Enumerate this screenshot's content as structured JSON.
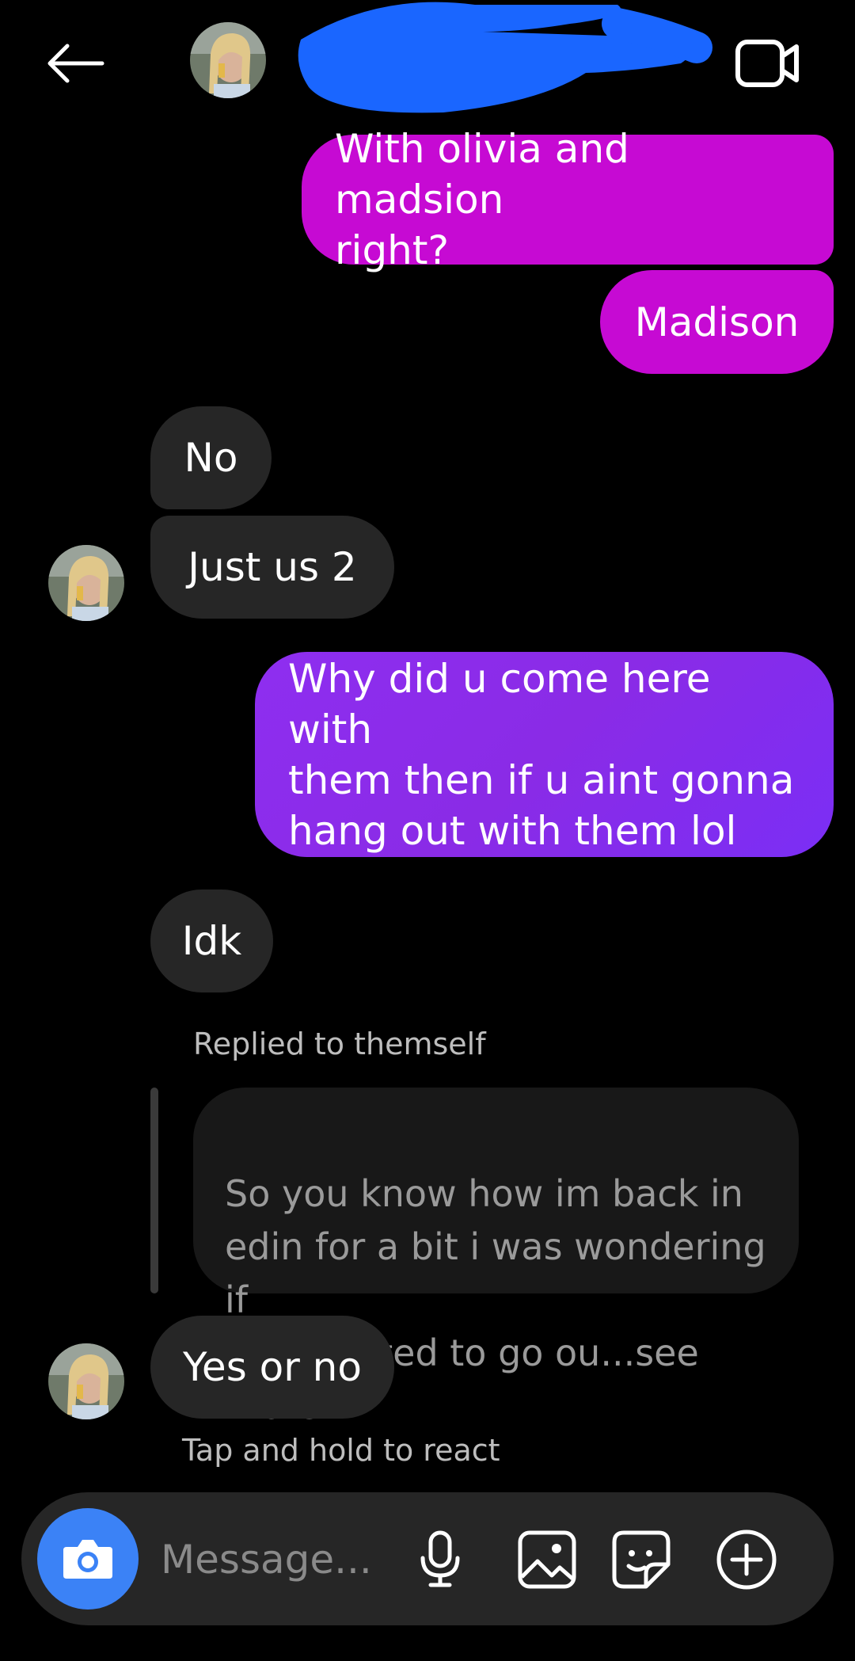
{
  "header": {
    "back_icon": "arrow-left-icon",
    "avatar_icon": "profile-photo-icon",
    "redaction_color": "#1a66ff",
    "video_icon": "video-camera-icon"
  },
  "messages": [
    {
      "side": "sent",
      "text": "With olivia and madsion\nright?"
    },
    {
      "side": "sent",
      "text": "Madison"
    },
    {
      "side": "received",
      "text": "No"
    },
    {
      "side": "received",
      "text": "Just us 2"
    },
    {
      "side": "sent",
      "text": "Why did u come here with\nthem then if u aint gonna\nhang out with them lol"
    },
    {
      "side": "received",
      "text": "Idk"
    },
    {
      "side": "received",
      "text": "Yes or no"
    }
  ],
  "reply": {
    "label": "Replied to themself",
    "quoted_text": "So you know  how im back in\nedin for a bit i was wondering if\nyou wanted to go ou...see more"
  },
  "hint": "Tap and hold to react",
  "composer": {
    "placeholder": "Message...",
    "camera_icon": "camera-icon",
    "mic_icon": "microphone-icon",
    "gallery_icon": "image-icon",
    "sticker_icon": "sticker-icon",
    "plus_icon": "plus-circle-icon"
  },
  "colors": {
    "background": "#000000",
    "sent_bubble": "#c60ad3",
    "sent_bubble_purple": "#8a2be6",
    "received_bubble": "#262626",
    "camera_button": "#3b82f6"
  }
}
